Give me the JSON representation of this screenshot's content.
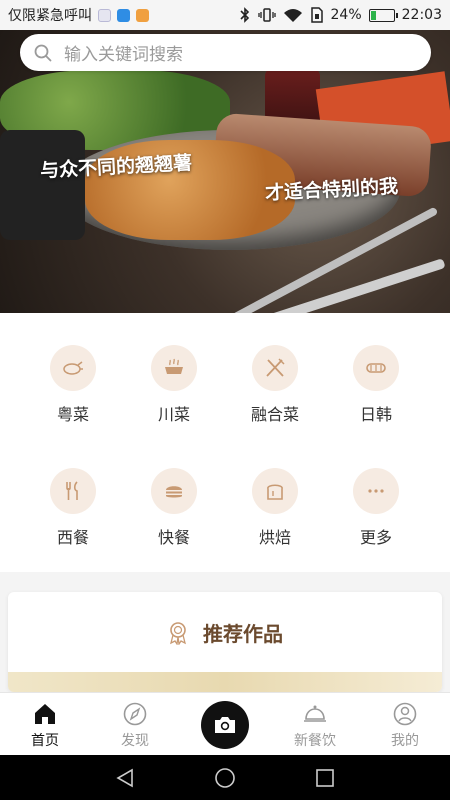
{
  "status_bar": {
    "left_text": "仅限紧急呼叫",
    "battery": "24%",
    "battery_level": 0.24,
    "time": "22:03",
    "icons": [
      "bluetooth-icon",
      "vibrate-icon",
      "wifi-icon",
      "sim-icon",
      "battery-icon"
    ]
  },
  "search": {
    "placeholder": "输入关键词搜索",
    "icon": "search-icon"
  },
  "banner": {
    "line1": "与众不同的翘翘薯",
    "line2": "才适合特别的我"
  },
  "categories": [
    {
      "label": "粤菜",
      "icon": "chicken-icon"
    },
    {
      "label": "川菜",
      "icon": "hotpot-icon"
    },
    {
      "label": "融合菜",
      "icon": "fork-knife-cross-icon"
    },
    {
      "label": "日韩",
      "icon": "sushi-icon"
    },
    {
      "label": "西餐",
      "icon": "western-cutlery-icon"
    },
    {
      "label": "快餐",
      "icon": "burger-icon"
    },
    {
      "label": "烘焙",
      "icon": "bread-icon"
    },
    {
      "label": "更多",
      "icon": "more-icon"
    }
  ],
  "recommend": {
    "title": "推荐作品",
    "icon": "award-icon"
  },
  "tabs": [
    {
      "label": "首页",
      "icon": "home-icon",
      "active": true
    },
    {
      "label": "发现",
      "icon": "compass-icon",
      "active": false
    },
    {
      "label": "",
      "icon": "camera-icon",
      "active": false
    },
    {
      "label": "新餐饮",
      "icon": "cloche-icon",
      "active": false
    },
    {
      "label": "我的",
      "icon": "profile-icon",
      "active": false
    }
  ],
  "colors": {
    "accent": "#c89a73",
    "icon_bg": "#f6ebe2",
    "title": "#6b4a2e",
    "battery": "#2db34a"
  }
}
